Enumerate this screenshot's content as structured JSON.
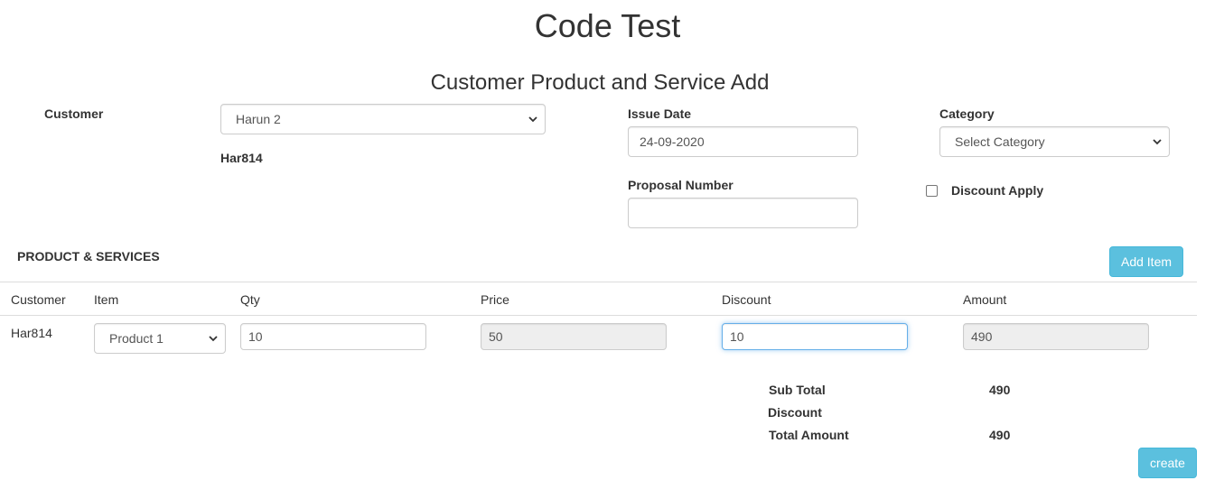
{
  "page": {
    "title": "Code Test",
    "subtitle": "Customer Product and Service Add"
  },
  "form": {
    "customer_label": "Customer",
    "customer_selected": "Harun 2",
    "customer_code": "Har814",
    "issue_date_label": "Issue Date",
    "issue_date_value": "24-09-2020",
    "category_label": "Category",
    "category_selected": "Select Category",
    "proposal_label": "Proposal Number",
    "proposal_value": "",
    "discount_apply_label": "Discount Apply",
    "discount_apply_checked": false
  },
  "products": {
    "section_title": "PRODUCT & SERVICES",
    "add_item_label": "Add Item",
    "columns": [
      "Customer",
      "Item",
      "Qty",
      "Price",
      "Discount",
      "Amount"
    ],
    "rows": [
      {
        "customer": "Har814",
        "item": "Product 1",
        "qty": "10",
        "price": "50",
        "discount": "10",
        "amount": "490"
      }
    ]
  },
  "totals": {
    "subtotal_label": "Sub Total",
    "subtotal_value": "490",
    "discount_label": "Discount",
    "discount_value": "",
    "total_label": "Total Amount",
    "total_value": "490"
  },
  "actions": {
    "create_label": "create"
  },
  "colors": {
    "info_button": "#5bc0de",
    "focus_border": "#66afe9",
    "readonly_bg": "#eeeeee"
  }
}
